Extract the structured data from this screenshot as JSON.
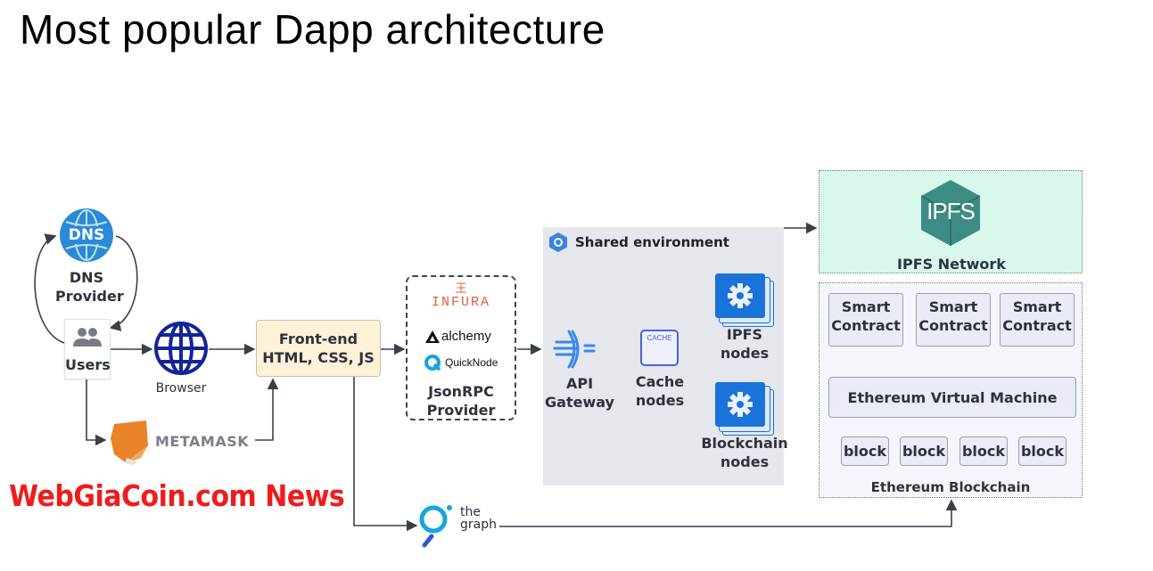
{
  "title": "Most popular Dapp architecture",
  "nodes": {
    "dns": {
      "icon": "dns-globe-icon",
      "badge": "DNS",
      "label_line1": "DNS",
      "label_line2": "Provider"
    },
    "users": {
      "icon": "users-icon",
      "label": "Users"
    },
    "browser": {
      "icon": "globe-icon",
      "label": "Browser"
    },
    "metamask": {
      "icon": "metamask-fox-icon",
      "label": "METAMASK"
    },
    "frontend": {
      "line1": "Front-end",
      "line2": "HTML, CSS, JS"
    },
    "jsonrpc": {
      "providers": [
        {
          "icon": "infura-icon",
          "name": "INFURA"
        },
        {
          "icon": "alchemy-icon",
          "name": "alchemy"
        },
        {
          "icon": "quicknode-icon",
          "name": "QuickNode"
        }
      ],
      "label_line1": "JsonRPC",
      "label_line2": "Provider"
    },
    "shared_env": {
      "icon": "gcp-hexagon-icon",
      "label": "Shared environment"
    },
    "api_gateway": {
      "icon": "api-gateway-icon",
      "label_line1": "API",
      "label_line2": "Gateway"
    },
    "cache": {
      "icon_text": "CACHE",
      "label_line1": "Cache",
      "label_line2": "nodes"
    },
    "ipfs_nodes": {
      "icon": "gear-icon",
      "label_line1": "IPFS",
      "label_line2": "nodes"
    },
    "blockchain_nodes": {
      "icon": "gear-icon",
      "label_line1": "Blockchain",
      "label_line2": "nodes"
    },
    "ipfs_network": {
      "logo_text": "IPFS",
      "label": "IPFS Network"
    },
    "ethereum": {
      "smart_contracts": [
        {
          "line1": "Smart",
          "line2": "Contract"
        },
        {
          "line1": "Smart",
          "line2": "Contract"
        },
        {
          "line1": "Smart",
          "line2": "Contract"
        }
      ],
      "evm": "Ethereum Virtual Machine",
      "blocks": [
        "block",
        "block",
        "block",
        "block"
      ],
      "label": "Ethereum Blockchain"
    },
    "thegraph": {
      "icon": "thegraph-icon",
      "line1": "the",
      "line2": "graph"
    }
  },
  "watermark": "WebGiaCoin.com News",
  "colors": {
    "dns_blue": "#2a8ad6",
    "browser_navy": "#13249a",
    "frontend_bg": "#fdf1d8",
    "shared_bg": "#e5e7ec",
    "node_blue": "#1a73d9",
    "ipfs_teal": "#3d8b85",
    "ipfs_bg": "#d8f8ec",
    "infura_orange": "#f0583a",
    "quicknode_cyan": "#1aa3d8",
    "watermark_red": "#ee1c1c"
  }
}
